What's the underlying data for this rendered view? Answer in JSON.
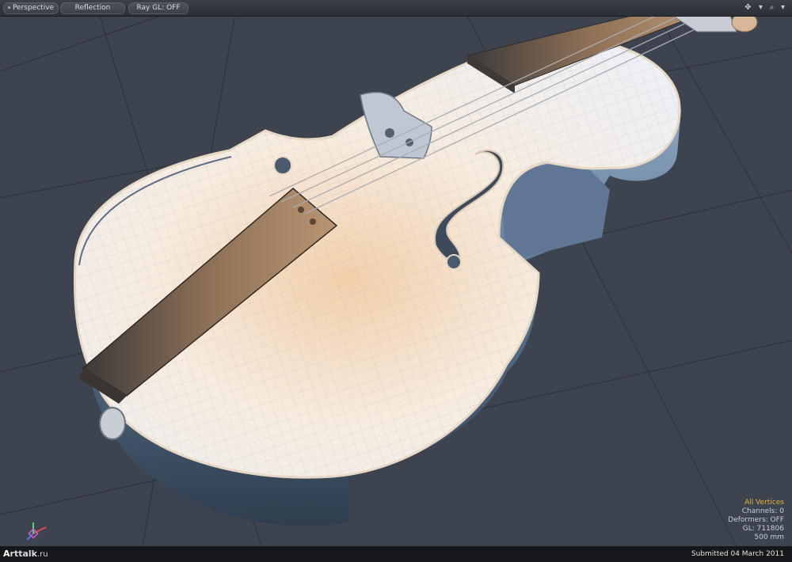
{
  "toolbar": {
    "view_mode": "Perspective",
    "shading": "Reflection",
    "raygl": "Ray GL: OFF"
  },
  "icons": {
    "nav": "navigate-icon",
    "zoom": "search-icon",
    "options": "chevron-down-icon"
  },
  "info": {
    "selection": "All Vertices",
    "channels": "Channels: 0",
    "deformers": "Deformers: OFF",
    "gl": "GL: 711806",
    "scale": "500 mm"
  },
  "footer": {
    "logo_prefix": "A",
    "logo_main": "rttalk",
    "logo_suffix": ".ru",
    "submitted": "Submitted 04 March 2011"
  },
  "colors": {
    "viewport_bg": "#3d4450",
    "accent_text": "#e8b23a",
    "body_light": "#f6efe8",
    "body_warm": "#e9c7a4",
    "rib_shadow": "#4f6a88",
    "fingerboard": "#6b5743"
  }
}
